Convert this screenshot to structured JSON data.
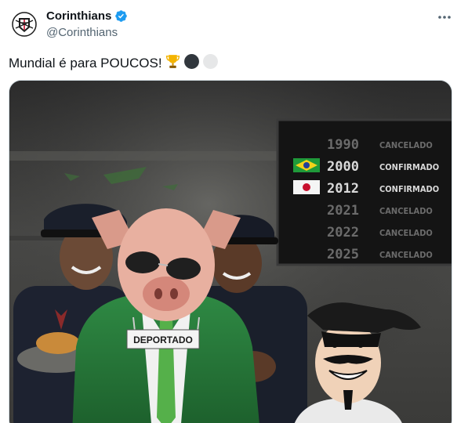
{
  "account": {
    "display_name": "Corinthians",
    "handle": "@Corinthians",
    "verified_icon": "verified-badge-icon",
    "avatar_icon": "corinthians-crest-icon"
  },
  "tweet": {
    "text": "Mundial é para POUCOS!",
    "emojis": [
      "trophy-icon",
      "black-circle-icon",
      "white-circle-icon"
    ]
  },
  "media": {
    "board_rows": [
      {
        "year": "1990",
        "status": "CANCELADO",
        "flag": "none"
      },
      {
        "year": "2000",
        "status": "CONFIRMADO",
        "flag": "brazil"
      },
      {
        "year": "2012",
        "status": "CONFIRMADO",
        "flag": "japan"
      },
      {
        "year": "2021",
        "status": "CANCELADO",
        "flag": "none"
      },
      {
        "year": "2022",
        "status": "CANCELADO",
        "flag": "none"
      },
      {
        "year": "2025",
        "status": "CANCELADO",
        "flag": "none"
      }
    ],
    "sign_text": "DEPORTADO"
  },
  "colors": {
    "text_primary": "#0f1419",
    "text_secondary": "#536471",
    "verified_blue": "#1d9bf0",
    "board_dim": "#6b6b6b",
    "board_lit": "#d9d9d9"
  }
}
